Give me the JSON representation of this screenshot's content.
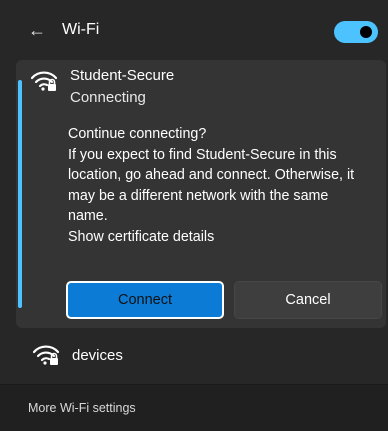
{
  "header": {
    "back_icon": "arrow-left-icon",
    "title": "Wi-Fi",
    "toggle_on": true,
    "accent_color": "#4cc2ff"
  },
  "active_network": {
    "icon": "wifi-secured-icon",
    "name": "Student-Secure",
    "status": "Connecting",
    "prompt_lines": [
      "Continue connecting?",
      "If you expect to find Student-Secure in this",
      "location, go ahead and connect. Otherwise, it",
      "may be a different network with the same",
      "name.",
      "Show certificate details"
    ],
    "connect_label": "Connect",
    "cancel_label": "Cancel"
  },
  "other_networks": [
    {
      "icon": "wifi-secured-icon",
      "name": "devices"
    }
  ],
  "footer": {
    "more_settings_label": "More Wi-Fi settings"
  }
}
